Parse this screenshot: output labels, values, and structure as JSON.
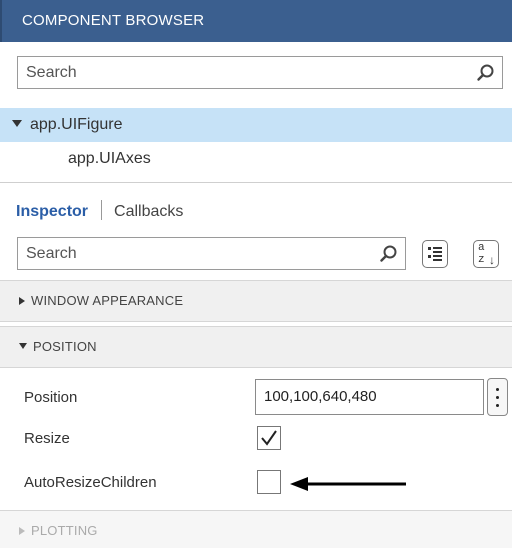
{
  "header": {
    "title": "COMPONENT BROWSER"
  },
  "browser_search": {
    "placeholder": "Search"
  },
  "tree": {
    "root": "app.UIFigure",
    "children": [
      "app.UIAxes"
    ]
  },
  "tabs": {
    "inspector": "Inspector",
    "callbacks": "Callbacks"
  },
  "inspector_search": {
    "placeholder": "Search"
  },
  "view_buttons": {
    "az_top": "a",
    "az_bottom": "z"
  },
  "sections": {
    "window_appearance": "WINDOW APPEARANCE",
    "position": "POSITION",
    "plotting": "PLOTTING"
  },
  "properties": {
    "position_label": "Position",
    "position_value": "100,100,640,480",
    "resize_label": "Resize",
    "resize_checked": true,
    "autoresize_label": "AutoResizeChildren",
    "autoresize_checked": false
  },
  "colors": {
    "header": "#3b5f8f",
    "selected_row": "#c6e2f7",
    "tab_active": "#2b5ea7"
  }
}
